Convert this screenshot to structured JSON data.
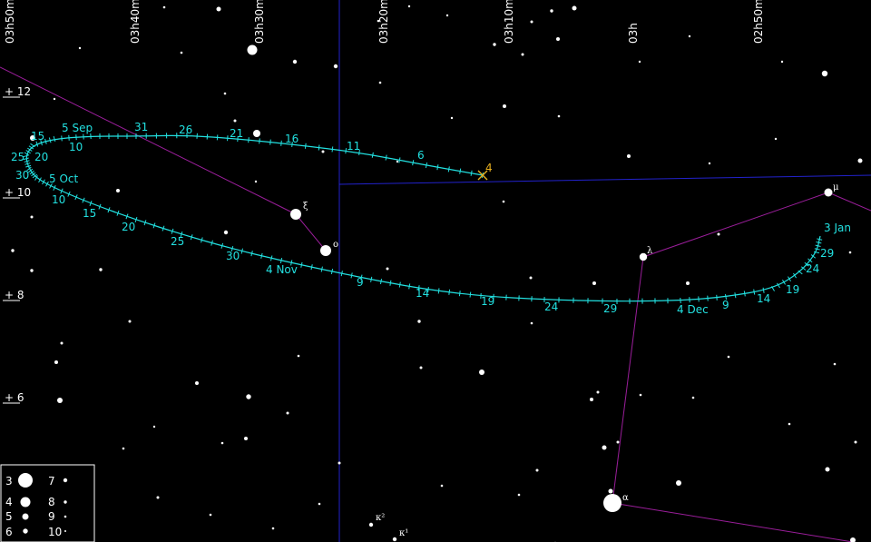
{
  "colors": {
    "background": "#000000",
    "grid": "#2222cc",
    "constellation": "#9a1e9a",
    "path": "#22e0e0",
    "start_marker": "#e8b020",
    "stars": "#ffffff"
  },
  "ra_labels": [
    "03h50m",
    "03h40m",
    "03h30m",
    "03h20m",
    "03h10m",
    "03h",
    "02h50m"
  ],
  "dec_labels": [
    "+ 12",
    "+ 10",
    "+ 8",
    "+ 6"
  ],
  "path_start_label": "4",
  "path_dates": [
    "6",
    "11",
    "16",
    "21",
    "26",
    "31",
    "5 Sep",
    "10",
    "15",
    "20",
    "25",
    "30",
    "5 Oct",
    "10",
    "15",
    "20",
    "25",
    "30",
    "4 Nov",
    "9",
    "14",
    "19",
    "24",
    "29",
    "4 Dec",
    "9",
    "14",
    "19",
    "24",
    "29",
    "3 Jan"
  ],
  "star_labels": [
    "ξ",
    "ο",
    "λ",
    "μ",
    "α",
    "κ²",
    "κ¹"
  ],
  "legend": {
    "magnitudes": [
      "3",
      "4",
      "5",
      "6",
      "7",
      "8",
      "9",
      "10"
    ]
  }
}
